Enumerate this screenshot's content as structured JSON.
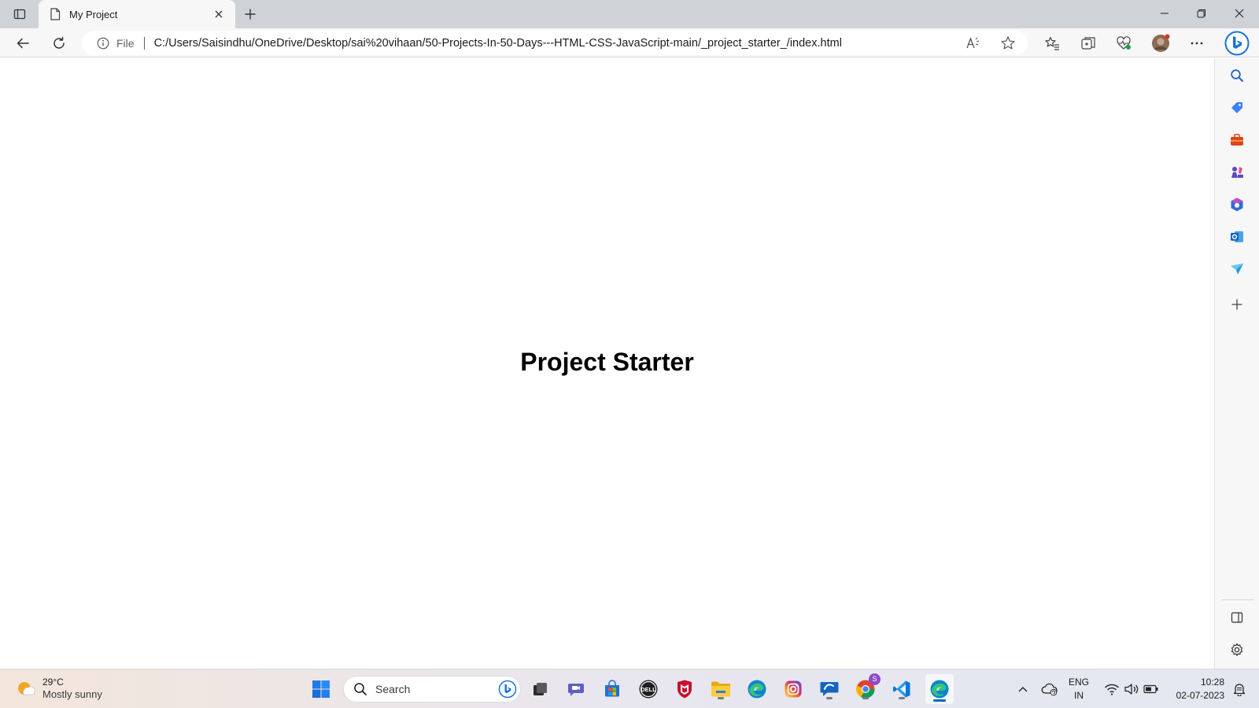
{
  "browser": {
    "tab_title": "My Project",
    "address": {
      "scheme_label": "File",
      "url": "C:/Users/Saisindhu/OneDrive/Desktop/sai%20vihaan/50-Projects-In-50-Days---HTML-CSS-JavaScript-main/_project_starter_/index.html"
    }
  },
  "page": {
    "heading": "Project Starter"
  },
  "sidebar": {
    "icons": [
      "search-icon",
      "shopping-tag-icon",
      "tools-icon",
      "games-icon",
      "office-icon",
      "outlook-icon",
      "send-icon",
      "add-icon"
    ],
    "bottom_icons": [
      "split-screen-icon",
      "settings-icon"
    ]
  },
  "taskbar": {
    "weather": {
      "temp": "29°C",
      "condition": "Mostly sunny"
    },
    "search_placeholder": "Search",
    "apps": [
      "windows-start-icon",
      "task-view-icon",
      "teams-icon",
      "store-icon",
      "dell-icon",
      "mcafee-icon",
      "file-explorer-icon",
      "edge-icon",
      "instagram-icon",
      "chat-app-icon",
      "chrome-icon",
      "vscode-icon",
      "edge-active-icon"
    ],
    "chrome_badge": "S",
    "language": {
      "line1": "ENG",
      "line2": "IN"
    },
    "clock": {
      "time": "10:28",
      "date": "02-07-2023"
    }
  },
  "colors": {
    "accent": "#0067c0",
    "tab_strip": "#cfd3d7"
  }
}
